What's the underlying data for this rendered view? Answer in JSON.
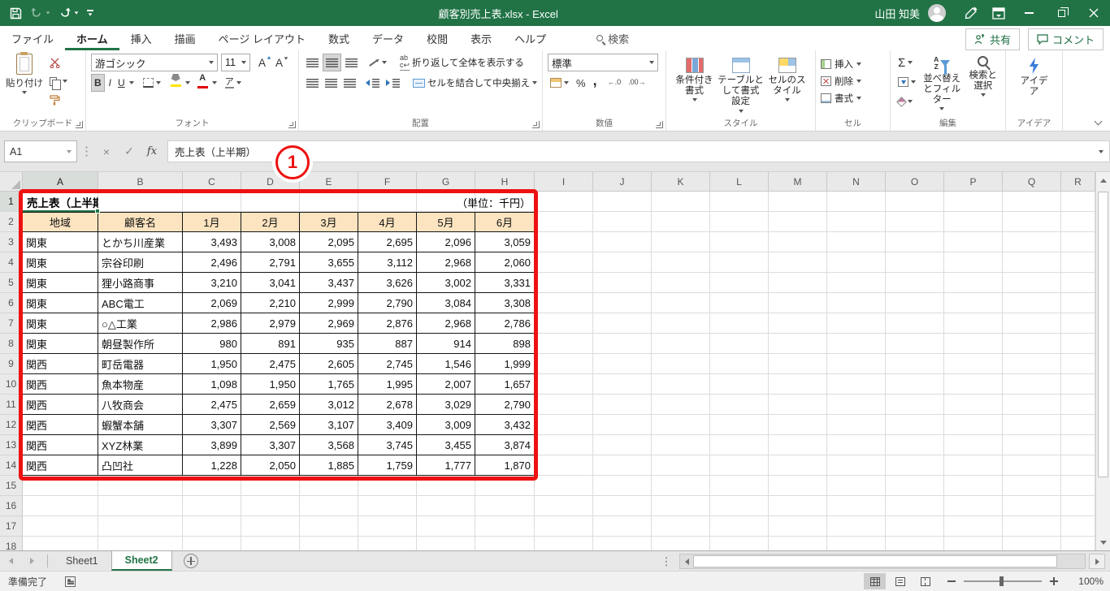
{
  "colors": {
    "excel_green": "#217346",
    "annotation_red": "#EE1111",
    "table_header_fill": "#FCE4C0"
  },
  "title_bar": {
    "title": "顧客別売上表.xlsx - Excel",
    "user": "山田 知美"
  },
  "ribbon_tabs": [
    {
      "label": "ファイル",
      "active": false
    },
    {
      "label": "ホーム",
      "active": true
    },
    {
      "label": "挿入",
      "active": false
    },
    {
      "label": "描画",
      "active": false
    },
    {
      "label": "ページ レイアウト",
      "active": false
    },
    {
      "label": "数式",
      "active": false
    },
    {
      "label": "データ",
      "active": false
    },
    {
      "label": "校閲",
      "active": false
    },
    {
      "label": "表示",
      "active": false
    },
    {
      "label": "ヘルプ",
      "active": false
    }
  ],
  "search_label": "検索",
  "share_label": "共有",
  "comment_label": "コメント",
  "ribbon": {
    "clipboard": {
      "paste": "貼り付け",
      "label": "クリップボード"
    },
    "font": {
      "name": "游ゴシック",
      "size": "11",
      "bold": "B",
      "italic": "I",
      "underline": "U",
      "size_letter": "A",
      "color_letter": "A",
      "phonetic": "ア",
      "label": "フォント"
    },
    "alignment": {
      "wrap": "折り返して全体を表示する",
      "merge": "セルを結合して中央揃え",
      "label": "配置"
    },
    "number": {
      "format": "標準",
      "percent": "%",
      "comma": ",",
      "inc_decimal": "←.0",
      "dec_decimal": ".00→",
      "label": "数値"
    },
    "styles": {
      "conditional": "条件付き書式",
      "table_format": "テーブルとして書式設定",
      "cell_styles": "セルのスタイル",
      "label": "スタイル"
    },
    "cells": {
      "insert": "挿入",
      "delete": "削除",
      "format": "書式",
      "label": "セル"
    },
    "editing": {
      "autosum": "Σ",
      "sort_filter": "並べ替えとフィルター",
      "find_select": "検索と選択",
      "label": "編集"
    },
    "ideas": {
      "button": "アイデア",
      "label": "アイデア"
    }
  },
  "formula_bar": {
    "name_box": "A1",
    "cancel": "×",
    "enter": "✓",
    "fx": "fx",
    "content": "売上表（上半期）"
  },
  "annotation": {
    "number": "1"
  },
  "sheet": {
    "columns": [
      "A",
      "B",
      "C",
      "D",
      "E",
      "F",
      "G",
      "H",
      "I",
      "J",
      "K",
      "L",
      "M",
      "N",
      "O",
      "P",
      "Q",
      "R"
    ],
    "visible_rows": 18,
    "selected_cell": "A1",
    "table": {
      "title": "売上表（上半期）",
      "unit_note": "（単位：千円）",
      "header_row": [
        "地域",
        "顧客名",
        "1月",
        "2月",
        "3月",
        "4月",
        "5月",
        "6月"
      ],
      "rows": [
        [
          "関東",
          "とかち川産業",
          "3,493",
          "3,008",
          "2,095",
          "2,695",
          "2,096",
          "3,059"
        ],
        [
          "関東",
          "宗谷印刷",
          "2,496",
          "2,791",
          "3,655",
          "3,112",
          "2,968",
          "2,060"
        ],
        [
          "関東",
          "狸小路商事",
          "3,210",
          "3,041",
          "3,437",
          "3,626",
          "3,002",
          "3,331"
        ],
        [
          "関東",
          "ABC電工",
          "2,069",
          "2,210",
          "2,999",
          "2,790",
          "3,084",
          "3,308"
        ],
        [
          "関東",
          "○△工業",
          "2,986",
          "2,979",
          "2,969",
          "2,876",
          "2,968",
          "2,786"
        ],
        [
          "関東",
          "朝昼製作所",
          "980",
          "891",
          "935",
          "887",
          "914",
          "898"
        ],
        [
          "関西",
          "町岳電器",
          "1,950",
          "2,475",
          "2,605",
          "2,745",
          "1,546",
          "1,999"
        ],
        [
          "関西",
          "魚本物産",
          "1,098",
          "1,950",
          "1,765",
          "1,995",
          "2,007",
          "1,657"
        ],
        [
          "関西",
          "八牧商会",
          "2,475",
          "2,659",
          "3,012",
          "2,678",
          "3,029",
          "2,790"
        ],
        [
          "関西",
          "蝦蟹本舗",
          "3,307",
          "2,569",
          "3,107",
          "3,409",
          "3,009",
          "3,432"
        ],
        [
          "関西",
          "XYZ林業",
          "3,899",
          "3,307",
          "3,568",
          "3,745",
          "3,455",
          "3,874"
        ],
        [
          "関西",
          "凸凹社",
          "1,228",
          "2,050",
          "1,885",
          "1,759",
          "1,777",
          "1,870"
        ]
      ]
    }
  },
  "sheet_tabs": {
    "tabs": [
      {
        "label": "Sheet1",
        "active": false
      },
      {
        "label": "Sheet2",
        "active": true
      }
    ]
  },
  "status_bar": {
    "ready": "準備完了",
    "zoom": "100%"
  }
}
